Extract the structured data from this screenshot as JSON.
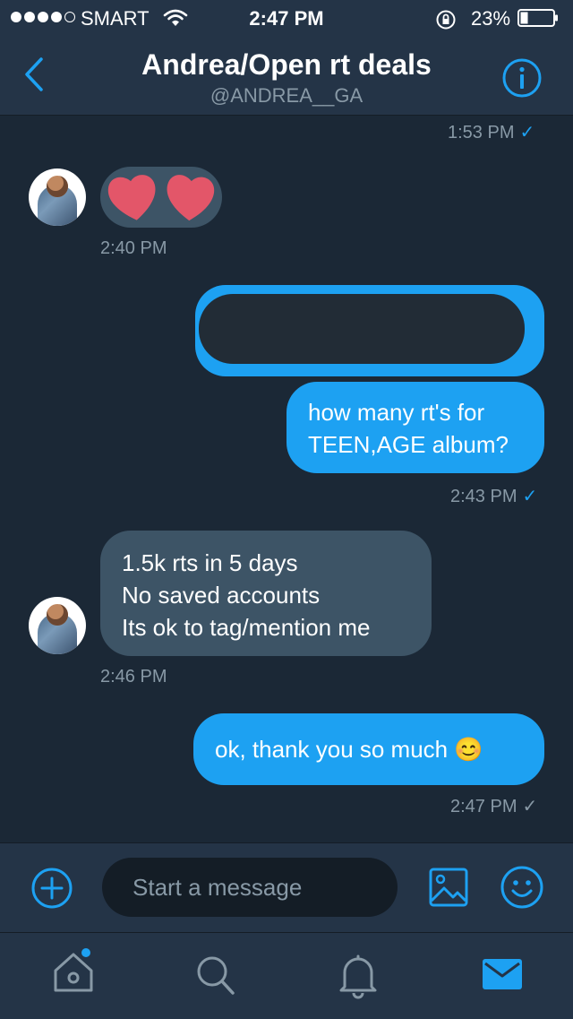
{
  "status_bar": {
    "carrier": "SMART",
    "time": "2:47 PM",
    "battery": "23%"
  },
  "header": {
    "name": "Andrea/Open rt deals",
    "handle": "@ANDREA__GA",
    "back_icon": "chevron-left-icon",
    "info_icon": "info-icon"
  },
  "messages": [
    {
      "side": "out",
      "timestamp": "1:53 PM",
      "status": "sent"
    },
    {
      "side": "in",
      "kind": "sticker",
      "stickers": [
        "heart",
        "heart"
      ],
      "timestamp": "2:40 PM"
    },
    {
      "side": "out",
      "kind": "redacted"
    },
    {
      "side": "out",
      "lines": [
        "how many rt's for",
        "TEEN,AGE album?"
      ],
      "timestamp": "2:43 PM",
      "status": "sent"
    },
    {
      "side": "in",
      "lines": [
        "1.5k rts in 5 days",
        "No saved accounts",
        "Its ok to tag/mention me"
      ],
      "timestamp": "2:46 PM"
    },
    {
      "side": "out",
      "lines": [
        "ok, thank you so much 😊"
      ],
      "timestamp": "2:47 PM",
      "status": "read"
    }
  ],
  "composer": {
    "placeholder": "Start a message",
    "add_icon": "plus-circle-icon",
    "image_icon": "image-icon",
    "emoji_icon": "emoji-icon"
  },
  "tabs": [
    {
      "name": "home",
      "icon": "home-icon",
      "has_badge": true
    },
    {
      "name": "search",
      "icon": "search-icon"
    },
    {
      "name": "notifications",
      "icon": "bell-icon"
    },
    {
      "name": "messages",
      "icon": "mail-icon",
      "active": true
    }
  ],
  "colors": {
    "background": "#1b2836",
    "bar": "#243447",
    "accent": "#1da1f2",
    "incoming_bubble": "#3d5466",
    "muted_text": "#8899a6"
  }
}
